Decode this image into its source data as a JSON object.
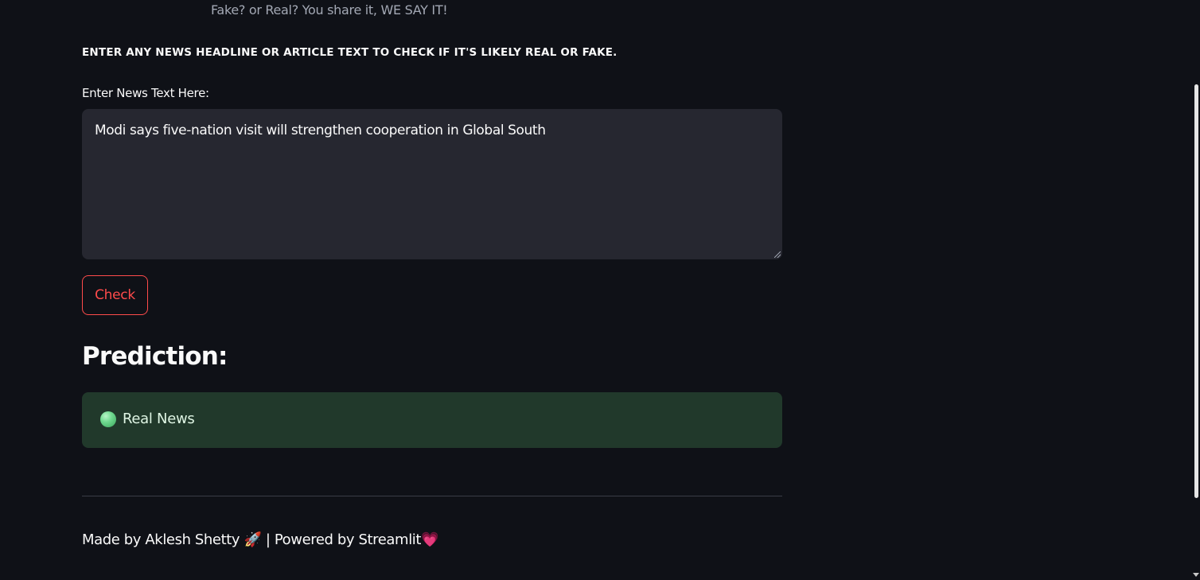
{
  "header": {
    "tagline": "Fake? or Real? You share it, WE SAY IT!"
  },
  "main": {
    "instruction": "ENTER ANY NEWS HEADLINE OR ARTICLE TEXT TO CHECK IF IT'S LIKELY REAL OR FAKE.",
    "input_label": "Enter News Text Here:",
    "input_value": "Modi says five-nation visit will strengthen cooperation in Global South",
    "check_button_label": "Check",
    "prediction_heading": "Prediction:",
    "result": {
      "icon": "green-circle-icon",
      "label": "Real News",
      "color": "#21392b"
    }
  },
  "footer": {
    "text": "Made by Aklesh Shetty 🚀 | Powered by Streamlit💗"
  },
  "colors": {
    "background": "#0f1117",
    "accent": "#ff4b4b",
    "input_bg": "#262730",
    "success_bg": "#21392b"
  }
}
